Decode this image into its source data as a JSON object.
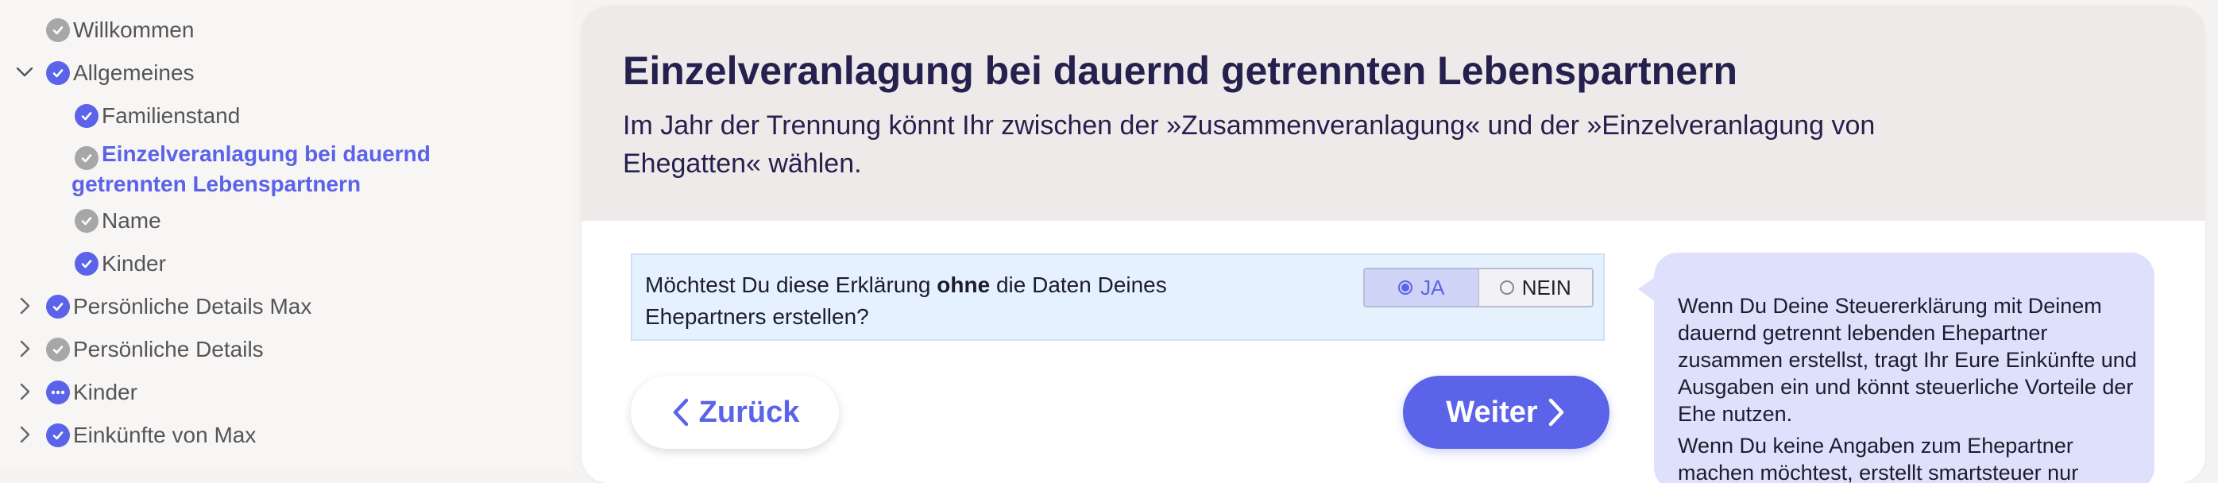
{
  "sidebar": {
    "items": [
      {
        "label": "Willkommen"
      },
      {
        "label": "Allgemeines"
      },
      {
        "label": "Familienstand"
      },
      {
        "label": "Einzelveranlagung bei dauernd getrennten Lebenspartnern"
      },
      {
        "label": "Name"
      },
      {
        "label": "Kinder"
      },
      {
        "label": "Persönliche Details Max"
      },
      {
        "label": "Persönliche Details"
      },
      {
        "label": "Kinder"
      },
      {
        "label": "Einkünfte von Max"
      }
    ]
  },
  "header": {
    "title": "Einzelveranlagung bei dauernd getrennten Lebenspartnern",
    "subtitle": "Im Jahr der Trennung könnt Ihr zwischen der »Zusammenveranlagung« und der »Einzelveranlagung von Ehegatten« wählen."
  },
  "question": {
    "text_before": "Möchtest Du diese Erklärung ",
    "text_bold": "ohne",
    "text_after": " die Daten Deines Ehepartners erstellen?",
    "option_yes": "JA",
    "option_no": "NEIN",
    "selected": "JA"
  },
  "buttons": {
    "back_label": "Zurück",
    "next_label": "Weiter"
  },
  "help": {
    "p1": "Wenn Du Deine Steuererklärung mit Deinem dauernd getrennt lebenden Ehepartner zusammen erstellst, tragt Ihr Eure Einkünfte und Ausgaben ein und könnt steuerliche Vorteile der Ehe nutzen.",
    "p2": "Wenn Du keine Angaben zum Ehepartner machen möchtest, erstellt smartsteuer nur"
  },
  "colors": {
    "accent": "#5b63e8",
    "sidebar_bg": "#f8f5f5",
    "header_bg": "#efeaea",
    "question_bg": "#e6f1fe",
    "help_bg": "#dfe0fc"
  }
}
